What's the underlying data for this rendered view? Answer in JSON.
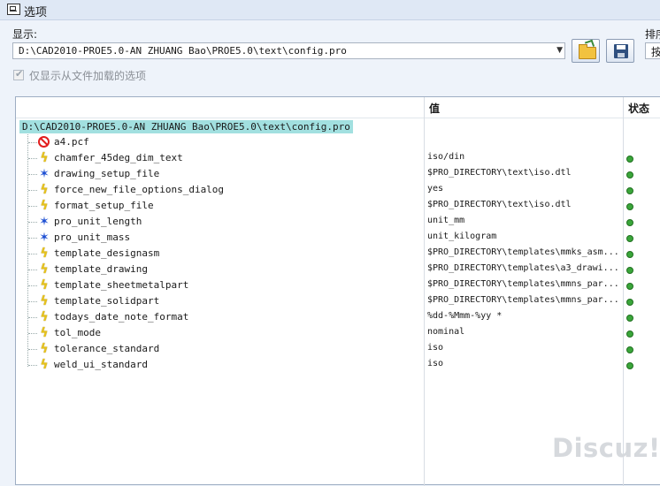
{
  "window": {
    "title": "选项"
  },
  "show": {
    "label": "显示:",
    "path": "D:\\CAD2010-PROE5.0-AN ZHUANG Bao\\PROE5.0\\text\\config.pro"
  },
  "sort": {
    "label": "排序",
    "value": "按"
  },
  "filter": {
    "label": "仅显示从文件加载的选项",
    "checked": true
  },
  "table": {
    "headers": {
      "value": "值",
      "status": "状态"
    },
    "root": "D:\\CAD2010-PROE5.0-AN ZHUANG Bao\\PROE5.0\\text\\config.pro",
    "rows": [
      {
        "name": "a4.pcf",
        "value": "",
        "icon": "stop-icon",
        "status": ""
      },
      {
        "name": "chamfer_45deg_dim_text",
        "value": "iso/din",
        "icon": "lightning-icon",
        "status": "green"
      },
      {
        "name": "drawing_setup_file",
        "value": "$PRO_DIRECTORY\\text\\iso.dtl",
        "icon": "blue-star-icon",
        "status": "green"
      },
      {
        "name": "force_new_file_options_dialog",
        "value": "yes",
        "icon": "lightning-icon",
        "status": "green"
      },
      {
        "name": "format_setup_file",
        "value": "$PRO_DIRECTORY\\text\\iso.dtl",
        "icon": "lightning-icon",
        "status": "green"
      },
      {
        "name": "pro_unit_length",
        "value": "unit_mm",
        "icon": "blue-star-icon",
        "status": "green"
      },
      {
        "name": "pro_unit_mass",
        "value": "unit_kilogram",
        "icon": "blue-star-icon",
        "status": "green"
      },
      {
        "name": "template_designasm",
        "value": "$PRO_DIRECTORY\\templates\\mmks_asm...",
        "icon": "lightning-icon",
        "status": "green"
      },
      {
        "name": "template_drawing",
        "value": "$PRO_DIRECTORY\\templates\\a3_drawi...",
        "icon": "lightning-icon",
        "status": "green"
      },
      {
        "name": "template_sheetmetalpart",
        "value": "$PRO_DIRECTORY\\templates\\mmns_par...",
        "icon": "lightning-icon",
        "status": "green"
      },
      {
        "name": "template_solidpart",
        "value": "$PRO_DIRECTORY\\templates\\mmns_par...",
        "icon": "lightning-icon",
        "status": "green"
      },
      {
        "name": "todays_date_note_format",
        "value": "%dd-%Mmm-%yy *",
        "icon": "lightning-icon",
        "status": "green"
      },
      {
        "name": "tol_mode",
        "value": "nominal",
        "icon": "lightning-icon",
        "status": "green"
      },
      {
        "name": "tolerance_standard",
        "value": "iso",
        "icon": "lightning-icon",
        "status": "green"
      },
      {
        "name": "weld_ui_standard",
        "value": "iso",
        "icon": "lightning-icon",
        "status": "green"
      }
    ]
  },
  "colors": {
    "status_ok": "#3aa63a",
    "root_highlight": "#a2e0e0",
    "lightning": "#e7c21a",
    "modified": "#1d4fd3"
  },
  "watermark": "Discuz!"
}
